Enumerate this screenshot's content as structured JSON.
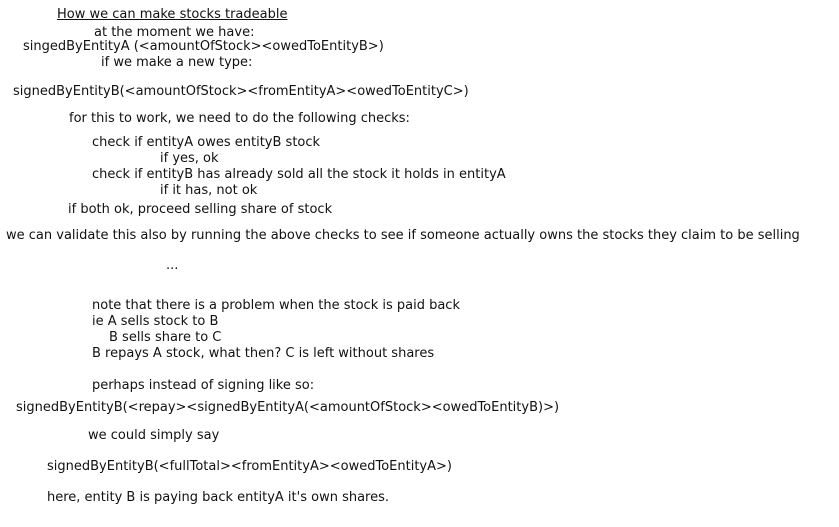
{
  "document": {
    "title": "How we can make stocks tradeable",
    "line_current": "at the moment we have:",
    "line_signed_a": "singedByEntityA (<amountOfStock><owedToEntityB>)",
    "line_new_type": "if we make a new type:",
    "line_signed_b": "signedByEntityB(<amountOfStock><fromEntityA><owedToEntityC>)",
    "line_checks_intro": "for this to work, we need to do the following checks:",
    "line_check1": "check if entityA owes entityB stock",
    "line_check1_result": "if yes, ok",
    "line_check2": "check if entityB has already sold all the stock it holds in entityA",
    "line_check2_result": "if it has, not ok",
    "line_proceed": "if both ok, proceed selling share of stock",
    "line_validate": "we can validate this also by running the above checks to see if someone actually owns the stocks they claim to be selling",
    "line_ellipsis": "...",
    "line_problem": "note that there is a problem when the stock is paid back",
    "line_ie": "ie A sells stock to B",
    "line_b_sells": "B sells share to C",
    "line_b_repays": "B repays A stock, what then? C is left without shares",
    "line_perhaps": "perhaps instead of signing like so:",
    "line_signed_repay": "signedByEntityB(<repay><signedByEntityA(<amountOfStock><owedToEntityB)>)",
    "line_simply": "we could simply say",
    "line_signed_full": "signedByEntityB(<fullTotal><fromEntityA><owedToEntityA>)",
    "line_here": "here, entity B is paying back entityA it's own shares."
  }
}
